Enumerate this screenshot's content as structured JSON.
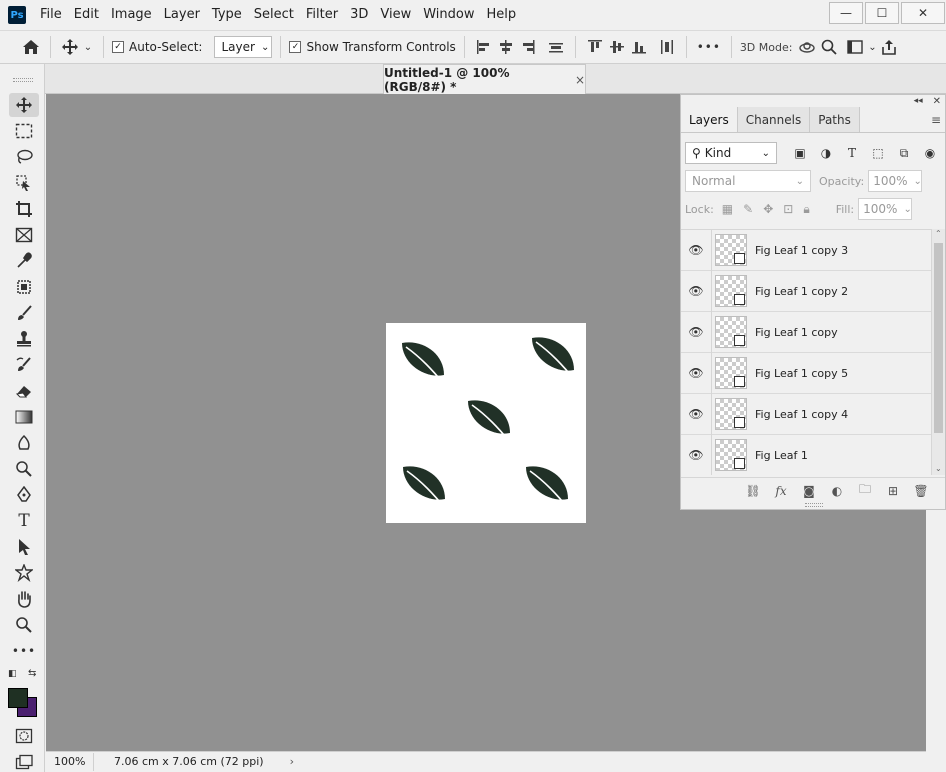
{
  "app": {
    "logo_text": "Ps"
  },
  "menu": [
    "File",
    "Edit",
    "Image",
    "Layer",
    "Type",
    "Select",
    "Filter",
    "3D",
    "View",
    "Window",
    "Help"
  ],
  "window_controls": {
    "minimize": "—",
    "maximize": "☐",
    "close": "✕"
  },
  "options": {
    "auto_select_label": "Auto-Select:",
    "auto_select_checked": true,
    "auto_select_target": "Layer",
    "show_transform_label": "Show Transform Controls",
    "show_transform_checked": true,
    "mode_3d_label": "3D Mode:",
    "more_label": "•••"
  },
  "document_tab": {
    "title": "Untitled-1 @ 100% (RGB/8#) *",
    "close": "×"
  },
  "status": {
    "zoom": "100%",
    "doc_size": "7.06 cm x 7.06 cm (72 ppi)",
    "arrow": "›"
  },
  "colors": {
    "foreground": "#1f3023",
    "background": "#4b2070",
    "leaf": "#213127",
    "canvas_bg": "#919191"
  },
  "panel": {
    "tabs": [
      "Layers",
      "Channels",
      "Paths"
    ],
    "active_tab": "Layers",
    "filter_kind": "Kind",
    "blend_mode": "Normal",
    "opacity_label": "Opacity:",
    "opacity_value": "100%",
    "lock_label": "Lock:",
    "fill_label": "Fill:",
    "fill_value": "100%",
    "layers": [
      {
        "name": "Fig Leaf 1 copy 3",
        "visible": true
      },
      {
        "name": "Fig Leaf 1 copy 2",
        "visible": true
      },
      {
        "name": "Fig Leaf 1 copy",
        "visible": true
      },
      {
        "name": "Fig Leaf 1 copy 5",
        "visible": true
      },
      {
        "name": "Fig Leaf 1 copy 4",
        "visible": true
      },
      {
        "name": "Fig Leaf 1",
        "visible": true
      }
    ],
    "footer_icons": [
      "link-icon",
      "fx-icon",
      "mask-icon",
      "adjustment-icon",
      "group-folder-icon",
      "new-layer-icon",
      "trash-icon"
    ],
    "fx_label": "fx"
  }
}
